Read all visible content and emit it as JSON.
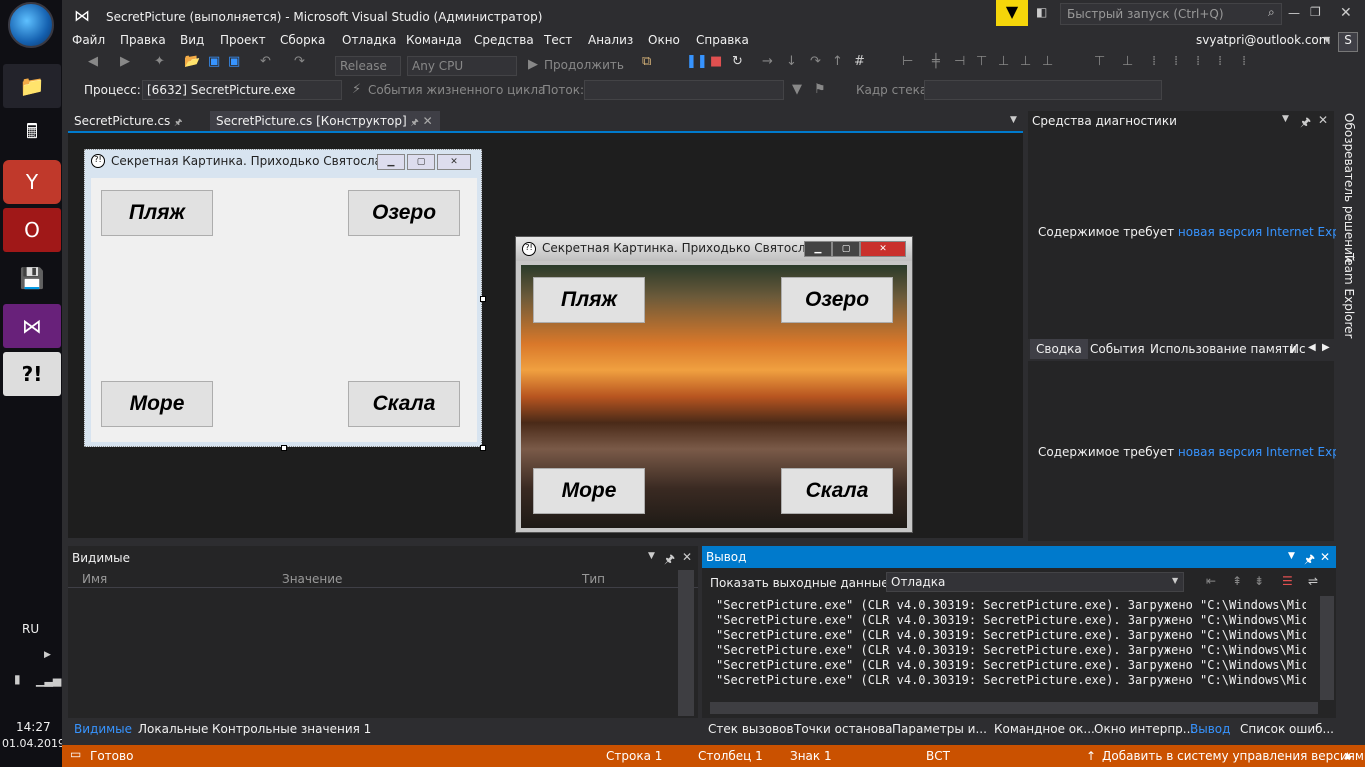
{
  "taskbar": {
    "lang": "RU",
    "time": "14:27",
    "date": "01.04.2019",
    "app4_glyph": "?!"
  },
  "window": {
    "title": "SecretPicture (выполняется) - Microsoft Visual Studio  (Администратор)",
    "quick_launch_placeholder": "Быстрый запуск (Ctrl+Q)",
    "user": "svyatpri@outlook.com",
    "user_initial": "S"
  },
  "menu": [
    "Файл",
    "Правка",
    "Вид",
    "Проект",
    "Сборка",
    "Отладка",
    "Команда",
    "Средства",
    "Тест",
    "Анализ",
    "Окно",
    "Справка"
  ],
  "toolbar": {
    "config": "Release",
    "platform": "Any CPU",
    "continue_label": "Продолжить",
    "process_label": "Процесс:",
    "process_value": "[6632] SecretPicture.exe",
    "lifecycle_label": "События жизненного цикла",
    "thread_label": "Поток:",
    "stack_label": "Кадр стека:"
  },
  "doc_tabs": [
    {
      "label": "SecretPicture.cs"
    },
    {
      "label": "SecretPicture.cs [Конструктор]"
    }
  ],
  "designer_form": {
    "title": "Секретная Картинка.   Приходько Святослав",
    "buttons": {
      "beach": "Пляж",
      "lake": "Озеро",
      "sea": "Море",
      "rock": "Скала"
    }
  },
  "running_form": {
    "title": "Секретная Картинка.   Приходько Святослав",
    "buttons": {
      "beach": "Пляж",
      "lake": "Озеро",
      "sea": "Море",
      "rock": "Скала"
    }
  },
  "diagnostics": {
    "title": "Средства диагностики",
    "msg_prefix": "Содержимое требует ",
    "msg_link": "новая версия Internet Explorer",
    "msg_suffix": ".",
    "tabs": [
      "Сводка",
      "События",
      "Использование памяти",
      "Ис"
    ]
  },
  "right_sidebar": [
    "Обозреватель решений",
    "Team Explorer"
  ],
  "locals": {
    "title": "Видимые",
    "columns": [
      "Имя",
      "Значение",
      "Тип"
    ],
    "tabs": [
      "Видимые",
      "Локальные",
      "Контрольные значения 1"
    ]
  },
  "output": {
    "title": "Вывод",
    "show_label": "Показать выходные данные из:",
    "source": "Отладка",
    "lines": [
      "\"SecretPicture.exe\" (CLR v4.0.30319: SecretPicture.exe). Загружено \"C:\\Windows\\Microso",
      "\"SecretPicture.exe\" (CLR v4.0.30319: SecretPicture.exe). Загружено \"C:\\Windows\\Microso",
      "\"SecretPicture.exe\" (CLR v4.0.30319: SecretPicture.exe). Загружено \"C:\\Windows\\Microso",
      "\"SecretPicture.exe\" (CLR v4.0.30319: SecretPicture.exe). Загружено \"C:\\Windows\\Microso",
      "\"SecretPicture.exe\" (CLR v4.0.30319: SecretPicture.exe). Загружено \"C:\\Windows\\Microso",
      "\"SecretPicture.exe\" (CLR v4.0.30319: SecretPicture.exe). Загружено \"C:\\Windows\\Microso"
    ],
    "tabs": [
      "Стек вызовов",
      "Точки останова",
      "Параметры и...",
      "Командное ок...",
      "Окно интерпр...",
      "Вывод",
      "Список ошиб..."
    ]
  },
  "status": {
    "ready": "Готово",
    "line": "Строка 1",
    "col": "Столбец 1",
    "ch": "Знак 1",
    "mode": "ВСТ",
    "vcs": "Добавить в систему управления версиями"
  },
  "colors": {
    "accent": "#007acc",
    "status": "#ca5100",
    "link": "#3794ff"
  }
}
